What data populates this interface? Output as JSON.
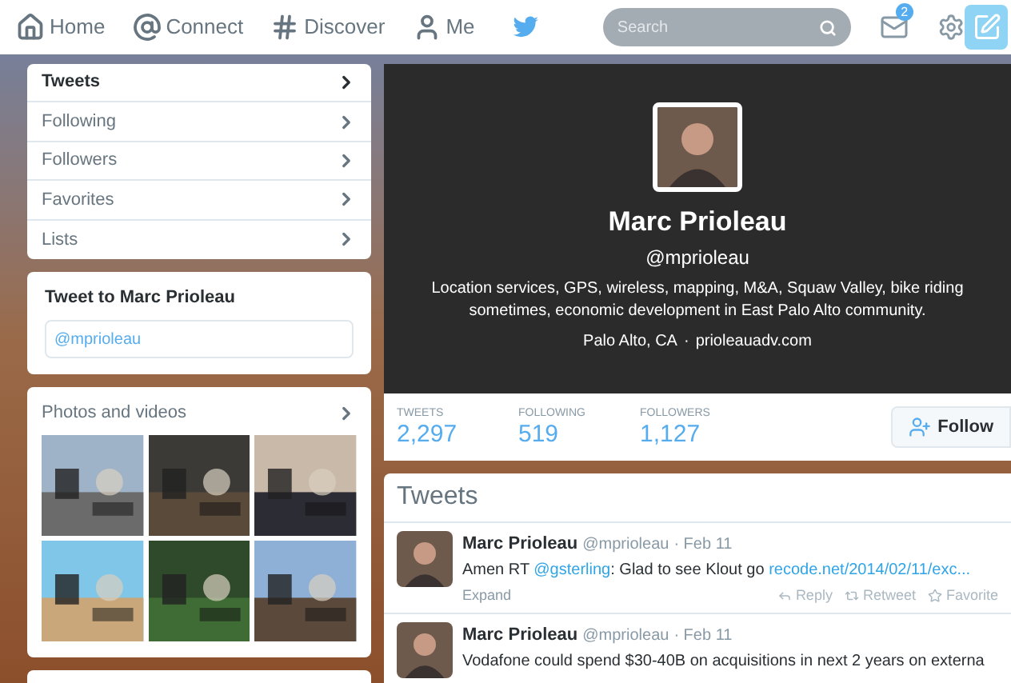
{
  "topbar": {
    "nav": [
      {
        "label": "Home"
      },
      {
        "label": "Connect"
      },
      {
        "label": "Discover"
      },
      {
        "label": "Me"
      }
    ],
    "search": {
      "placeholder": "Search"
    },
    "messages_badge": "2"
  },
  "sidebar": {
    "items": [
      {
        "label": "Tweets",
        "selected": true
      },
      {
        "label": "Following",
        "selected": false
      },
      {
        "label": "Followers",
        "selected": false
      },
      {
        "label": "Favorites",
        "selected": false
      },
      {
        "label": "Lists",
        "selected": false
      }
    ]
  },
  "tweet_box": {
    "title": "Tweet to Marc Prioleau",
    "value": "@mprioleau"
  },
  "photos": {
    "title": "Photos and videos"
  },
  "profile": {
    "name": "Marc Prioleau",
    "handle": "@mprioleau",
    "bio": "Location services, GPS, wireless, mapping, M&A, Squaw Valley, bike riding sometimes, economic development in East Palo Alto community.",
    "location": "Palo Alto, CA",
    "separator": "·",
    "url": "prioleauadv.com"
  },
  "stats": [
    {
      "label": "TWEETS",
      "value": "2,297"
    },
    {
      "label": "FOLLOWING",
      "value": "519"
    },
    {
      "label": "FOLLOWERS",
      "value": "1,127"
    }
  ],
  "follow_button": "Follow",
  "timeline": {
    "title": "Tweets",
    "tweets": [
      {
        "name": "Marc Prioleau",
        "handle": "@mprioleau",
        "date": "· Feb 11",
        "text": [
          {
            "kind": "text",
            "text": "Amen RT "
          },
          {
            "kind": "mention",
            "text": "@gsterling"
          },
          {
            "kind": "text",
            "text": ": Glad to see Klout go "
          },
          {
            "kind": "link",
            "text": "recode.net/2014/02/11/exc..."
          }
        ],
        "expand": "Expand",
        "actions": [
          "Reply",
          "Retweet",
          "Favorite"
        ]
      },
      {
        "name": "Marc Prioleau",
        "handle": "@mprioleau",
        "date": "· Feb 11",
        "text": [
          {
            "kind": "text",
            "text": "Vodafone could spend $30-40B on acquisitions in next 2 years on externa"
          }
        ]
      }
    ]
  }
}
